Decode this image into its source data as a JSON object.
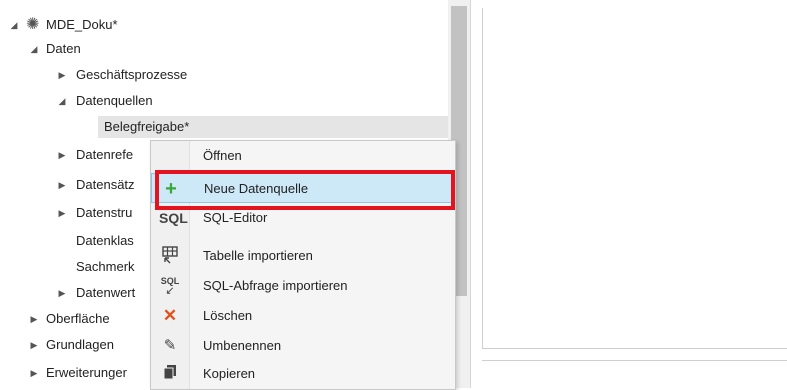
{
  "tree": {
    "root": {
      "label": "MDE_Doku*",
      "icon": "gear-bulb-icon"
    },
    "daten": {
      "label": "Daten"
    },
    "items": [
      {
        "label": "Geschäftsprozesse"
      },
      {
        "label": "Datenquellen"
      },
      {
        "label": "Belegfreigabe*"
      },
      {
        "label": "Datenrefe"
      },
      {
        "label": "Datensätz"
      },
      {
        "label": "Datenstru"
      },
      {
        "label": "Datenklas"
      },
      {
        "label": "Sachmerk"
      },
      {
        "label": "Datenwert"
      }
    ],
    "top": [
      {
        "label": "Oberfläche"
      },
      {
        "label": "Grundlagen"
      },
      {
        "label": "Erweiterunger"
      }
    ]
  },
  "context_menu": {
    "items": [
      {
        "label": "Öffnen",
        "icon": ""
      },
      {
        "label": "Neue Datenquelle",
        "icon": "plus-icon"
      },
      {
        "label": "SQL-Editor",
        "icon": "sql-icon",
        "icon_text": "SQL"
      },
      {
        "label": "Tabelle importieren",
        "icon": "table-import-icon"
      },
      {
        "label": "SQL-Abfrage importieren",
        "icon": "sql-import-icon",
        "icon_text": "SQL"
      },
      {
        "label": "Löschen",
        "icon": "delete-x-icon"
      },
      {
        "label": "Umbenennen",
        "icon": "pen-icon"
      },
      {
        "label": "Kopieren",
        "icon": "copy-icon"
      }
    ]
  },
  "colors": {
    "highlight": "#cde8f7",
    "plus": "#3aa63a",
    "delete": "#e0521b",
    "annotation": "#e3141f"
  }
}
